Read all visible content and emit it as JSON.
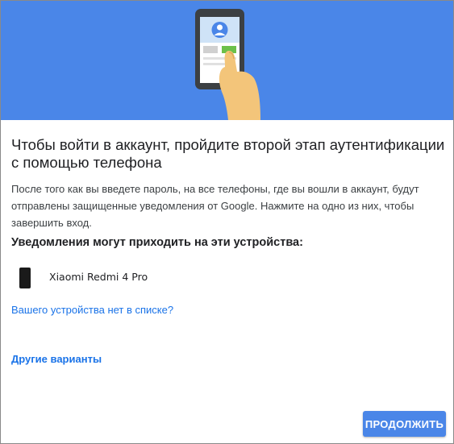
{
  "hero": {
    "illustration_icon": "phone-in-hand-illustration",
    "background_color": "#4a86e8"
  },
  "main": {
    "title": "Чтобы войти в аккаунт, пройдите второй этап аутентификации с помощью телефона",
    "description": "После того как вы введете пароль, на все телефоны, где вы вошли в аккаунт, будут отправлены защищенные уведомления от Google. Нажмите на одно из них, чтобы завершить вход.",
    "devices_heading": "Уведомления могут приходить на эти устройства:",
    "devices": [
      {
        "icon": "smartphone-icon",
        "name": "Xiaomi Redmi 4 Pro"
      }
    ],
    "device_missing_link": "Вашего устройства нет в списке?",
    "other_options_link": "Другие варианты"
  },
  "footer": {
    "continue_button": "ПРОДОЛЖИТЬ"
  },
  "colors": {
    "accent": "#4a86e8",
    "link": "#1a73e8",
    "text": "#202124"
  }
}
